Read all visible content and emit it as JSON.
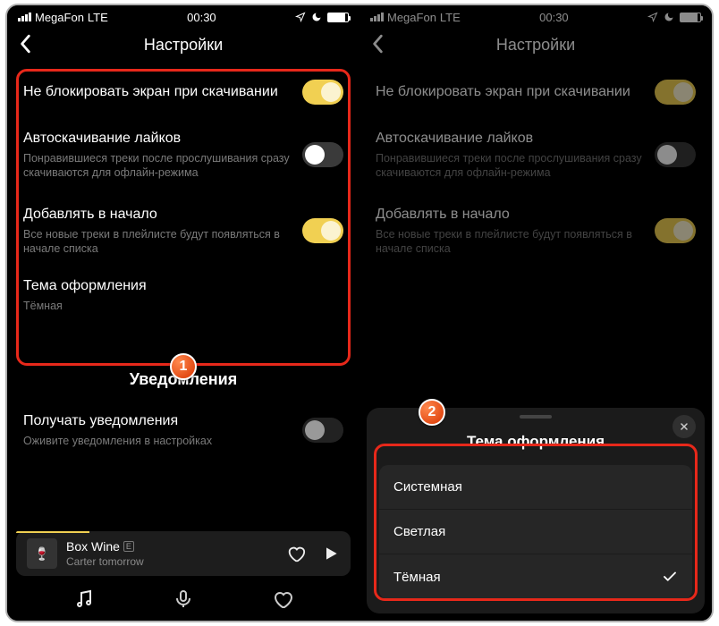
{
  "statusbar": {
    "carrier": "MegaFon",
    "network": "LTE",
    "time": "00:30"
  },
  "header": {
    "title": "Настройки"
  },
  "settings": {
    "block": {
      "title": "Не блокировать экран при скачивании",
      "on": true
    },
    "autolikes": {
      "title": "Автоскачивание лайков",
      "sub": "Понравившиеся треки после прослушивания сразу скачиваются для офлайн-режима",
      "on": false
    },
    "prepend": {
      "title": "Добавлять в начало",
      "sub": "Все новые треки в плейлисте будут появляться в начале списка",
      "on": true
    },
    "theme": {
      "title": "Тема оформления",
      "value": "Тёмная"
    }
  },
  "section_notify": "Уведомления",
  "notify": {
    "title": "Получать уведомления",
    "sub": "Оживите уведомления в настройках"
  },
  "player": {
    "track": "Box Wine",
    "explicit": "E",
    "artist": "Carter tomorrow"
  },
  "sheet": {
    "title": "Тема оформления",
    "options": [
      "Системная",
      "Светлая",
      "Тёмная"
    ],
    "selected": 2
  },
  "badges": {
    "one": "1",
    "two": "2"
  }
}
